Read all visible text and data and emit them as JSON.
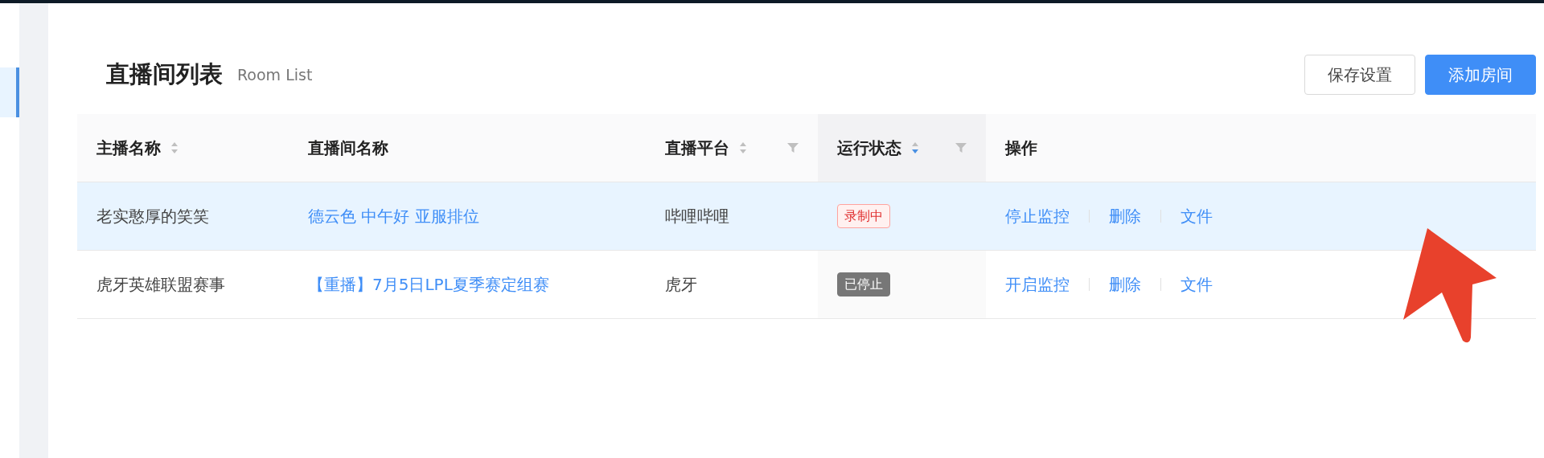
{
  "sidebar": {
    "items": [
      {
        "selected": true
      }
    ]
  },
  "header": {
    "title": "直播间列表",
    "subtitle": "Room List",
    "buttons": [
      {
        "label": "保存设置",
        "kind": "default"
      },
      {
        "label": "添加房间",
        "kind": "primary"
      }
    ]
  },
  "table": {
    "columns": [
      {
        "label": "主播名称",
        "sortable": true,
        "sort_descending": false,
        "filter": false
      },
      {
        "label": "直播间名称"
      },
      {
        "label": "直播平台",
        "sortable": true,
        "sort_descending": false,
        "filter": true
      },
      {
        "label": "运行状态",
        "sortable": true,
        "sort_descending": true,
        "filter": true
      },
      {
        "label": "操作"
      }
    ],
    "rows": [
      {
        "selected": true,
        "streamer": "老实憨厚的笑笑",
        "room": "德云色 中午好 亚服排位",
        "platform": "哔哩哔哩",
        "status": {
          "label": "录制中",
          "kind": "recording"
        },
        "actions": [
          "停止监控",
          "删除",
          "文件"
        ]
      },
      {
        "selected": false,
        "streamer": "虎牙英雄联盟赛事",
        "room": "【重播】7月5日LPL夏季赛定组赛",
        "platform": "虎牙",
        "status": {
          "label": "已停止",
          "kind": "stopped"
        },
        "actions": [
          "开启监控",
          "删除",
          "文件"
        ]
      }
    ]
  },
  "annotations": [
    {
      "kind": "arrow"
    }
  ]
}
